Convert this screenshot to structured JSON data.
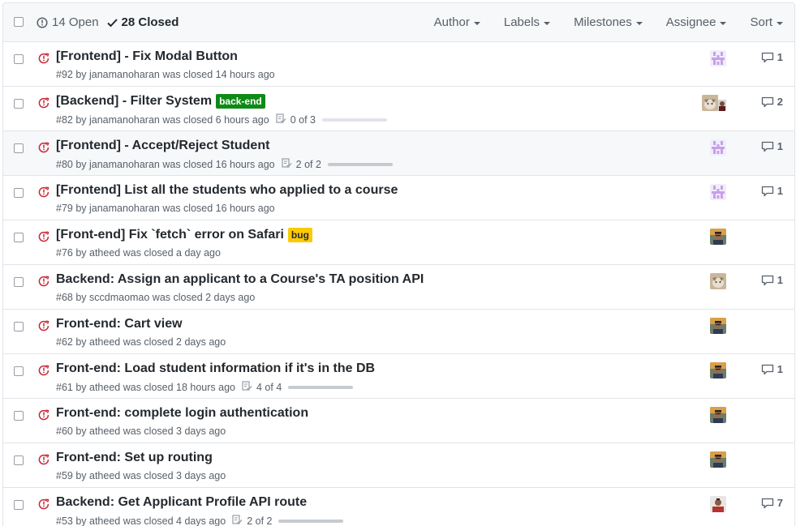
{
  "header": {
    "open_label": "14 Open",
    "closed_label": "28 Closed",
    "filters": [
      "Author",
      "Labels",
      "Milestones",
      "Assignee",
      "Sort"
    ]
  },
  "colors": {
    "closed_red": "#cb2431",
    "label_backend": "#0e8a16",
    "label_bug": "#fbca04"
  },
  "issues": [
    {
      "title": "[Frontend] - Fix Modal Button",
      "label": "",
      "meta": "#92 by janamanoharan was closed 14 hours ago",
      "tasks": "",
      "avatar": "identicon",
      "comments": "1"
    },
    {
      "title": "[Backend] - Filter System",
      "label": "back-end",
      "meta": "#82 by janamanoharan was closed 6 hours ago",
      "tasks": "0 of 3",
      "avatar": "cat+person",
      "comments": "2"
    },
    {
      "title": "[Frontend] - Accept/Reject Student",
      "label": "",
      "meta": "#80 by janamanoharan was closed 16 hours ago",
      "tasks": "2 of 2",
      "avatar": "identicon",
      "comments": "1"
    },
    {
      "title": "[Frontend] List all the students who applied to a course",
      "label": "",
      "meta": "#79 by janamanoharan was closed 16 hours ago",
      "tasks": "",
      "avatar": "identicon",
      "comments": "1"
    },
    {
      "title": "[Front-end] Fix `fetch` error on Safari",
      "label": "bug",
      "meta": "#76 by atheed was closed a day ago",
      "tasks": "",
      "avatar": "person",
      "comments": ""
    },
    {
      "title": "Backend: Assign an applicant to a Course's TA position API",
      "label": "",
      "meta": "#68 by sccdmaomao was closed 2 days ago",
      "tasks": "",
      "avatar": "cat",
      "comments": "1"
    },
    {
      "title": "Front-end: Cart view",
      "label": "",
      "meta": "#62 by atheed was closed 2 days ago",
      "tasks": "",
      "avatar": "person",
      "comments": ""
    },
    {
      "title": "Front-end: Load student information if it's in the DB",
      "label": "",
      "meta": "#61 by atheed was closed 18 hours ago",
      "tasks": "4 of 4",
      "avatar": "person",
      "comments": "1"
    },
    {
      "title": "Front-end: complete login authentication",
      "label": "",
      "meta": "#60 by atheed was closed 3 days ago",
      "tasks": "",
      "avatar": "person",
      "comments": ""
    },
    {
      "title": "Front-end: Set up routing",
      "label": "",
      "meta": "#59 by atheed was closed 3 days ago",
      "tasks": "",
      "avatar": "person",
      "comments": ""
    },
    {
      "title": "Backend: Get Applicant Profile API route",
      "label": "",
      "meta": "#53 by atheed was closed 4 days ago",
      "tasks": "2 of 2",
      "avatar": "person2",
      "comments": "7"
    }
  ]
}
